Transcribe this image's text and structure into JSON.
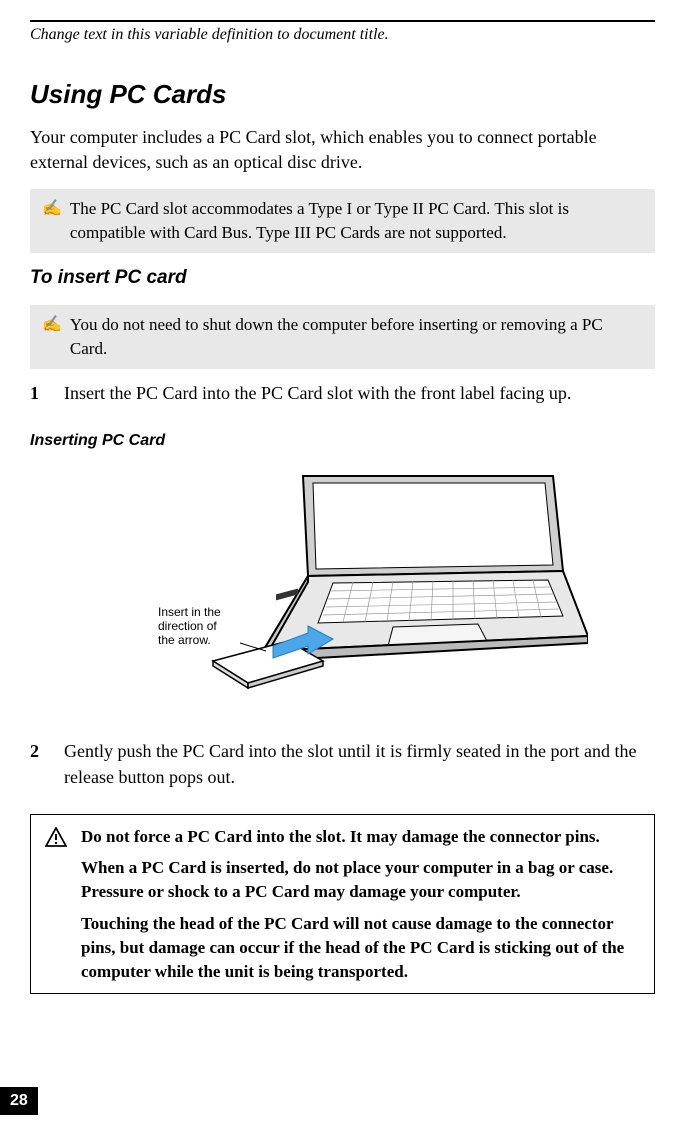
{
  "header": {
    "variable_title": "Change text in this variable definition to document title."
  },
  "h1": "Using PC Cards",
  "intro": "Your computer includes a PC Card slot, which enables you to connect portable external devices, such as an optical disc drive.",
  "note1": "The PC Card slot accommodates a Type I or Type II PC Card. This slot is compatible with Card Bus. Type III PC Cards are not supported.",
  "h2": "To insert PC card",
  "note2": "You do not need to shut down the computer before inserting or removing a PC Card.",
  "steps": {
    "s1_num": "1",
    "s1_text": "Insert the PC Card into the PC Card slot with the front label facing up.",
    "s2_num": "2",
    "s2_text": "Gently push the PC Card into the slot until it is firmly seated in the port and the release button pops out."
  },
  "h3": "Inserting PC Card",
  "figure_annotation": "Insert in the direction of the arrow.",
  "caution": {
    "p1": "Do not force a PC Card into the slot. It may damage the connector pins.",
    "p2": "When a PC Card is inserted, do not place your computer in a bag or case. Pressure or shock to a PC Card may damage your computer.",
    "p3": "Touching the head of the PC Card will not cause damage to the connector pins, but damage can occur if the head of the PC Card is sticking out of the computer while the unit is being transported."
  },
  "page_number": "28"
}
